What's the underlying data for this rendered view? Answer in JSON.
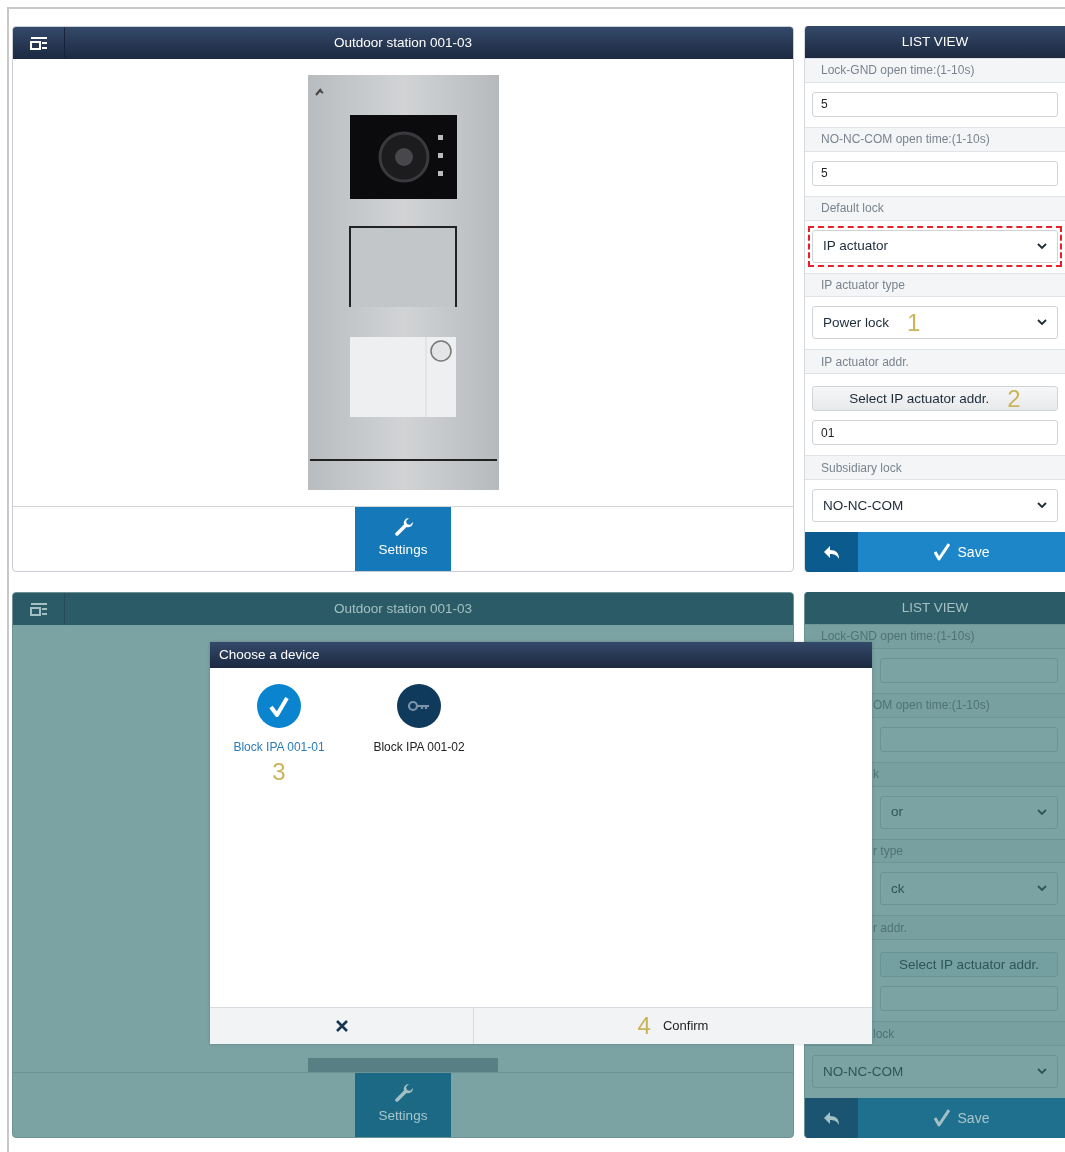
{
  "screens": [
    {
      "dimmed": false,
      "title": "Outdoor station 001-03",
      "settings": "Settings",
      "list_title": "LIST VIEW",
      "save": "Save",
      "fields": [
        {
          "kind": "label",
          "text": "Lock-GND open time:(1-10s)"
        },
        {
          "kind": "input",
          "value": "5"
        },
        {
          "kind": "label",
          "text": "NO-NC-COM open time:(1-10s)"
        },
        {
          "kind": "input",
          "value": "5"
        },
        {
          "kind": "label",
          "text": "Default lock"
        },
        {
          "kind": "select",
          "value": "IP actuator",
          "highlighted": true
        },
        {
          "kind": "label",
          "text": "IP actuator type"
        },
        {
          "kind": "select",
          "value": "Power lock",
          "highlighted": false,
          "marker": "1"
        },
        {
          "kind": "label",
          "text": "IP actuator addr."
        },
        {
          "kind": "button",
          "text": "Select IP actuator addr.",
          "marker": "2"
        },
        {
          "kind": "input",
          "value": "01"
        },
        {
          "kind": "label",
          "text": "Subsidiary lock"
        },
        {
          "kind": "select",
          "value": "NO-NC-COM",
          "highlighted": false
        }
      ]
    },
    {
      "dimmed": true,
      "title": "Outdoor station 001-03",
      "settings": "Settings",
      "list_title": "LIST VIEW",
      "save": "Save",
      "fields": [
        {
          "kind": "label",
          "text": "Lock-GND open time:(1-10s)"
        },
        {
          "kind": "input"
        },
        {
          "kind": "label",
          "text": "OM open time:(1-10s)"
        },
        {
          "kind": "input"
        },
        {
          "kind": "label",
          "text": "k"
        },
        {
          "kind": "select",
          "value": "or",
          "highlighted": false
        },
        {
          "kind": "label",
          "text": "r type"
        },
        {
          "kind": "select",
          "value": "ck",
          "highlighted": false
        },
        {
          "kind": "label",
          "text": "r addr."
        },
        {
          "kind": "button",
          "text": "Select IP actuator addr."
        },
        {
          "kind": "input"
        },
        {
          "kind": "label",
          "text": "lock"
        },
        {
          "kind": "select",
          "value": "NO-NC-COM",
          "highlighted": false
        }
      ],
      "dialog": {
        "title": "Choose a device",
        "devices": [
          {
            "name": "Block IPA 001-01",
            "selected": true,
            "marker": "3"
          },
          {
            "name": "Block IPA 001-02",
            "selected": false
          }
        ],
        "confirm": "Confirm",
        "confirm_marker": "4"
      }
    }
  ]
}
